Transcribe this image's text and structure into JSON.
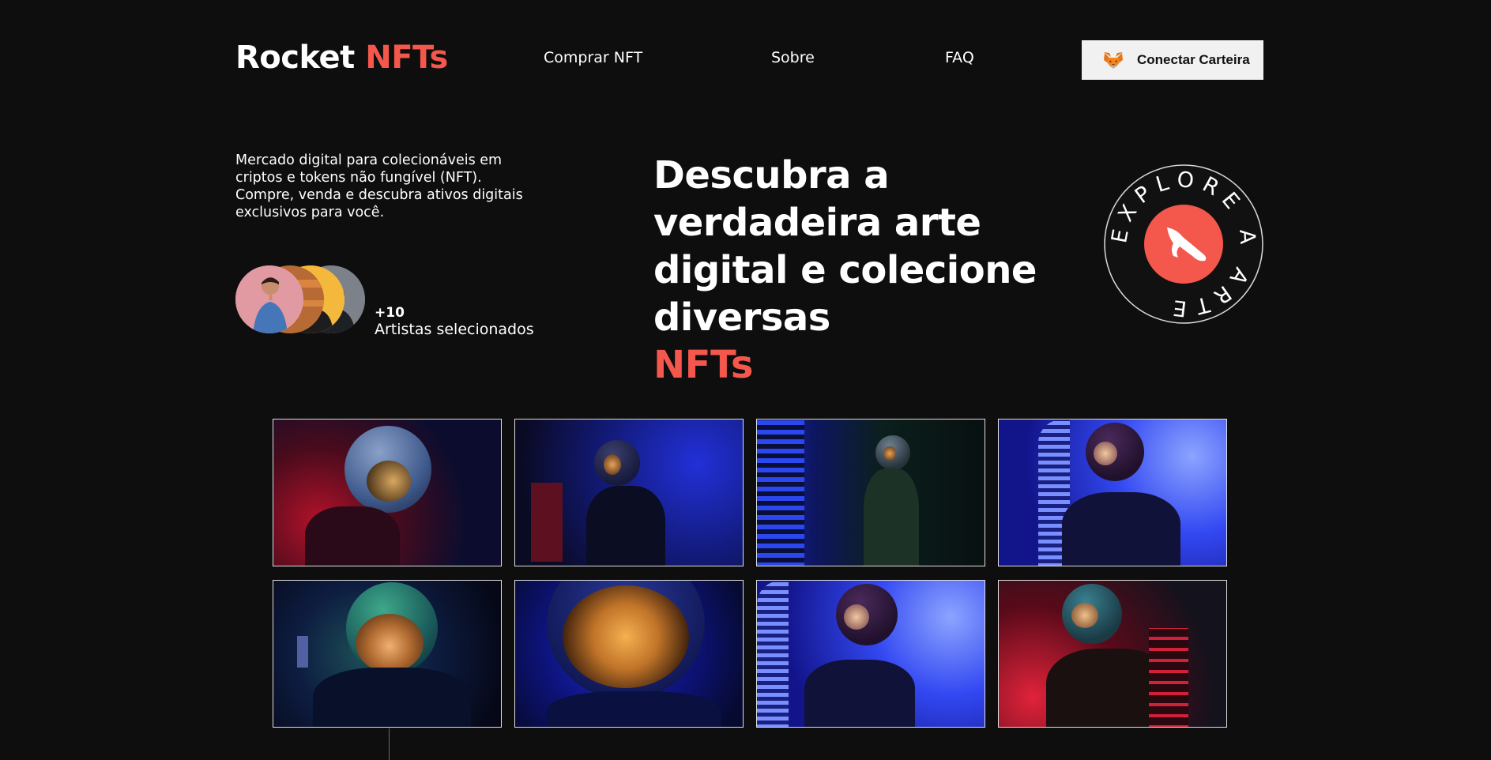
{
  "header": {
    "logo_main": "Rocket",
    "logo_accent": "NFTs",
    "nav": [
      {
        "label": "Comprar NFT"
      },
      {
        "label": "Sobre"
      },
      {
        "label": "FAQ"
      }
    ],
    "connect_button": "Conectar Carteira",
    "connect_icon": "metamask-fox-icon"
  },
  "hero": {
    "description": "Mercado digital para colecionáveis em criptos e tokens não fungível (NFT). Compre, venda e descubra ativos digitais exclusivos para você.",
    "artists_count": "+10",
    "artists_label": "Artistas selecionados",
    "headline": "Descubra a verdadeira arte digital e colecione diversas",
    "headline_accent": "NFTs",
    "badge_text": "EXPLORE A ARTE",
    "badge_icon": "rocket-icon"
  },
  "gallery": {
    "items": [
      {
        "name": "astronaut-1"
      },
      {
        "name": "astronaut-2"
      },
      {
        "name": "astronaut-3"
      },
      {
        "name": "astronaut-4"
      },
      {
        "name": "astronaut-5"
      },
      {
        "name": "astronaut-6"
      },
      {
        "name": "astronaut-7"
      },
      {
        "name": "astronaut-8"
      }
    ]
  },
  "colors": {
    "background": "#0e0e0e",
    "accent": "#f4574c",
    "text": "#ffffff",
    "button_bg": "#f1f1f1"
  }
}
